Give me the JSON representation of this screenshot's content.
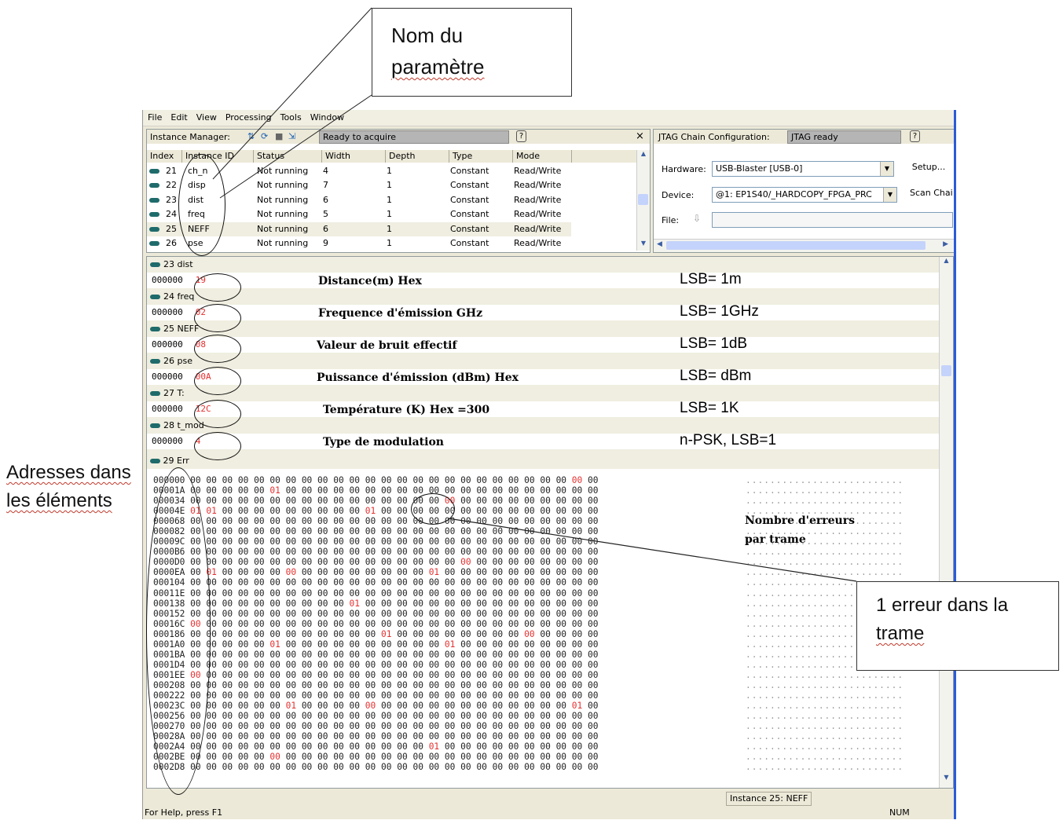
{
  "callouts": {
    "param_name": [
      "Nom du",
      "paramètre"
    ],
    "addresses": [
      "Adresses dans",
      "les éléments"
    ],
    "one_error": [
      "1 erreur dans la",
      "trame"
    ]
  },
  "menu": [
    "File",
    "Edit",
    "View",
    "Processing",
    "Tools",
    "Window"
  ],
  "instance_manager": {
    "label": "Instance Manager:",
    "status": "Ready to acquire",
    "help": "?",
    "close": "×",
    "columns": [
      "Index",
      "Instance ID",
      "Status",
      "Width",
      "Depth",
      "Type",
      "Mode"
    ],
    "rows": [
      {
        "index": "21",
        "id": "ch_n",
        "status": "Not running",
        "width": "4",
        "depth": "1",
        "type": "Constant",
        "mode": "Read/Write"
      },
      {
        "index": "22",
        "id": "disp",
        "status": "Not running",
        "width": "7",
        "depth": "1",
        "type": "Constant",
        "mode": "Read/Write"
      },
      {
        "index": "23",
        "id": "dist",
        "status": "Not running",
        "width": "6",
        "depth": "1",
        "type": "Constant",
        "mode": "Read/Write"
      },
      {
        "index": "24",
        "id": "freq",
        "status": "Not running",
        "width": "5",
        "depth": "1",
        "type": "Constant",
        "mode": "Read/Write"
      },
      {
        "index": "25",
        "id": "NEFF",
        "status": "Not running",
        "width": "6",
        "depth": "1",
        "type": "Constant",
        "mode": "Read/Write"
      },
      {
        "index": "26",
        "id": "pse",
        "status": "Not running",
        "width": "9",
        "depth": "1",
        "type": "Constant",
        "mode": "Read/Write"
      }
    ]
  },
  "jtag": {
    "label": "JTAG Chain Configuration:",
    "status": "JTAG ready",
    "help": "?",
    "hardware_label": "Hardware:",
    "hardware_value": "USB-Blaster [USB-0]",
    "setup": "Setup...",
    "device_label": "Device:",
    "device_value": "@1: EP1S40/_HARDCOPY_FPGA_PRC",
    "scan": "Scan Chai",
    "file_label": "File:"
  },
  "signals": [
    {
      "header": "23  dist",
      "addr": "000000",
      "value": "19",
      "annotation": "Distance(m) Hex",
      "lsb": "LSB= 1m"
    },
    {
      "header": "24  freq",
      "addr": "000000",
      "value": "02",
      "annotation": "Frequence d'émission GHz",
      "lsb": "LSB= 1GHz"
    },
    {
      "header": "25  NEFF",
      "addr": "000000",
      "value": "08",
      "annotation": "Valeur de bruit effectif",
      "lsb": "LSB= 1dB"
    },
    {
      "header": "26  pse",
      "addr": "000000",
      "value": "00A",
      "annotation": "Puissance d'émission (dBm) Hex",
      "lsb": "LSB=  dBm"
    },
    {
      "header": "27  T:",
      "addr": "000000",
      "value": "12C",
      "annotation": "Température (K) Hex =300",
      "lsb": "LSB= 1K"
    },
    {
      "header": "28  t_mod",
      "addr": "000000",
      "value": "4",
      "annotation": "Type de modulation",
      "lsb": "n-PSK,  LSB=1"
    }
  ],
  "memory_header": "29  Err",
  "memory": {
    "addresses": [
      "000000",
      "00001A",
      "000034",
      "00004E",
      "000068",
      "000082",
      "00009C",
      "0000B6",
      "0000D0",
      "0000EA",
      "000104",
      "00011E",
      "000138",
      "000152",
      "00016C",
      "000186",
      "0001A0",
      "0001BA",
      "0001D4",
      "0001EE",
      "000208",
      "000222",
      "00023C",
      "000256",
      "000270",
      "00028A",
      "0002A4",
      "0002BE",
      "0002D8"
    ],
    "ones": [
      [
        1,
        5
      ],
      [
        3,
        0
      ],
      [
        3,
        1
      ],
      [
        3,
        11
      ],
      [
        9,
        1
      ],
      [
        9,
        15
      ],
      [
        12,
        10
      ],
      [
        15,
        12
      ],
      [
        16,
        5
      ],
      [
        16,
        16
      ],
      [
        22,
        6
      ],
      [
        22,
        24
      ],
      [
        26,
        15
      ]
    ],
    "zeros_red": [
      [
        0,
        24
      ],
      [
        2,
        16
      ],
      [
        3,
        0
      ],
      [
        8,
        17
      ],
      [
        9,
        6
      ],
      [
        14,
        0
      ],
      [
        15,
        21
      ],
      [
        19,
        0
      ],
      [
        21,
        26
      ],
      [
        22,
        11
      ],
      [
        27,
        5
      ]
    ]
  },
  "annotation_errors": [
    "Nombre d'erreurs",
    "par trame"
  ],
  "status": {
    "instance": "Instance 25: NEFF",
    "help": "For Help, press F1",
    "num": "NUM"
  }
}
